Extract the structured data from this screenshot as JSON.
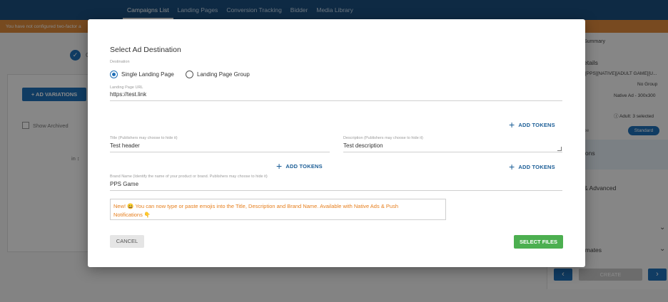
{
  "nav": {
    "items": [
      {
        "label": "Campaigns List",
        "active": true
      },
      {
        "label": "Landing Pages",
        "active": false
      },
      {
        "label": "Conversion Tracking",
        "active": false
      },
      {
        "label": "Bidder",
        "active": false
      },
      {
        "label": "Media Library",
        "active": false
      }
    ]
  },
  "warning": "You have not configured two-factor a",
  "background": {
    "step_label": "C",
    "ad_variations_label": "+ AD VARIATIONS",
    "show_archived_label": "Show Archived",
    "column_label": "in ↕",
    "right": {
      "summary": "Summary",
      "details": "etails",
      "campaign_name": "[PPS][NATIVE][ADULT GAME][U...",
      "group": "No Group",
      "format": "Native Ad - 300x300",
      "adult": "Adult: 3 selected",
      "type_label": "pe",
      "badge": "Standard",
      "options": "ions",
      "advanced": "& Advanced",
      "estimates": "imates",
      "create_label": "CREATE"
    }
  },
  "modal": {
    "title": "Select Ad Destination",
    "destination_label": "Destination",
    "radio_single": "Single Landing Page",
    "radio_group": "Landing Page Group",
    "selected_destination": "Single Landing Page",
    "landing_url_label": "Landing Page URL",
    "landing_url_value": "https://test.link",
    "add_tokens": "ADD TOKENS",
    "title_label": "Title (Publishers may choose to hide it)",
    "title_value": "Test header",
    "description_label": "Description (Publishers may choose to hide it)",
    "description_value": "Test description",
    "brand_label": "Brand Name (Identify the name of your product or brand. Publishers may choose to hide it)",
    "brand_value": "PPS Game",
    "notice_line1": "New! 😀 You can now type or paste emojis into the Title, Description and Brand Name. Available with Native Ads & Push",
    "notice_line2": "Notifications 👇",
    "cancel_label": "CANCEL",
    "select_files_label": "SELECT FILES"
  },
  "colors": {
    "primary": "#1f6fb7",
    "topbar": "#1a4f7f",
    "success": "#4caf50",
    "notice_text": "#e67e1c"
  }
}
